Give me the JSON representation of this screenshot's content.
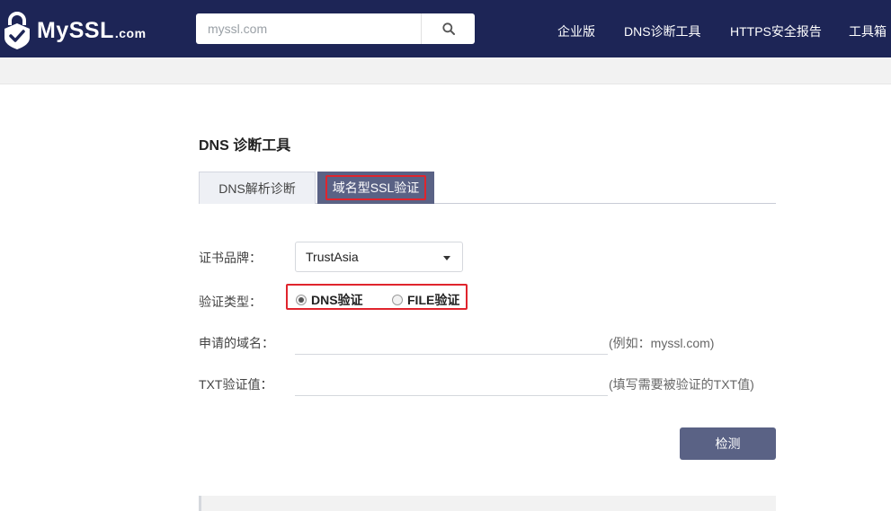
{
  "header": {
    "logo_text": "MySSL",
    "logo_suffix": ".com",
    "search_placeholder": "myssl.com",
    "nav": [
      "企业版",
      "DNS诊断工具",
      "HTTPS安全报告",
      "工具箱"
    ]
  },
  "page": {
    "title": "DNS 诊断工具",
    "tabs": [
      {
        "label": "DNS解析诊断",
        "active": false
      },
      {
        "label": "域名型SSL验证",
        "active": true
      }
    ]
  },
  "form": {
    "brand_label": "证书品牌：",
    "brand_value": "TrustAsia",
    "type_label": "验证类型：",
    "radio_dns": "DNS验证",
    "radio_file": "FILE验证",
    "domain_label": "申请的域名：",
    "domain_hint": "(例如：myssl.com)",
    "txt_label": "TXT验证值：",
    "txt_hint": "(填写需要被验证的TXT值)",
    "submit_label": "检测"
  },
  "colors": {
    "header_bg": "#1d2556",
    "accent": "#5a6285",
    "highlight_red": "#e0242d"
  }
}
